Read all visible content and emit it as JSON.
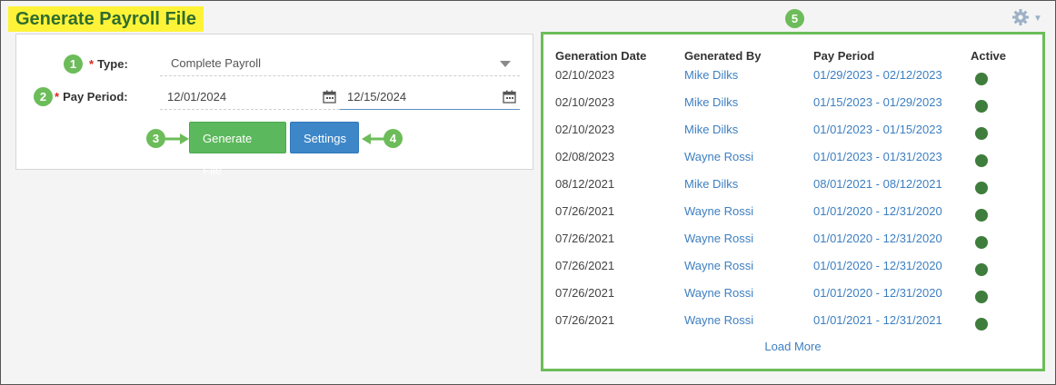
{
  "header": {
    "title": "Generate Payroll File",
    "settings_icon": "gear-icon"
  },
  "callouts": [
    "1",
    "2",
    "3",
    "4",
    "5"
  ],
  "form": {
    "type_label": "Type:",
    "type_required": "*",
    "type_value": "Complete Payroll",
    "period_label": "Pay Period:",
    "period_required": "*",
    "start_date": "12/01/2024",
    "end_date": "12/15/2024",
    "generate_button": "Generate File",
    "settings_button": "Settings"
  },
  "history": {
    "columns": [
      "Generation Date",
      "Generated By",
      "Pay Period",
      "Active"
    ],
    "rows": [
      {
        "date": "02/10/2023",
        "by": "Mike Dilks",
        "period": "01/29/2023 - 02/12/2023",
        "active": true
      },
      {
        "date": "02/10/2023",
        "by": "Mike Dilks",
        "period": "01/15/2023 - 01/29/2023",
        "active": true
      },
      {
        "date": "02/10/2023",
        "by": "Mike Dilks",
        "period": "01/01/2023 - 01/15/2023",
        "active": true
      },
      {
        "date": "02/08/2023",
        "by": "Wayne Rossi",
        "period": "01/01/2023 - 01/31/2023",
        "active": true
      },
      {
        "date": "08/12/2021",
        "by": "Mike Dilks",
        "period": "08/01/2021 - 08/12/2021",
        "active": true
      },
      {
        "date": "07/26/2021",
        "by": "Wayne Rossi",
        "period": "01/01/2020 - 12/31/2020",
        "active": true
      },
      {
        "date": "07/26/2021",
        "by": "Wayne Rossi",
        "period": "01/01/2020 - 12/31/2020",
        "active": true
      },
      {
        "date": "07/26/2021",
        "by": "Wayne Rossi",
        "period": "01/01/2020 - 12/31/2020",
        "active": true
      },
      {
        "date": "07/26/2021",
        "by": "Wayne Rossi",
        "period": "01/01/2020 - 12/31/2020",
        "active": true
      },
      {
        "date": "07/26/2021",
        "by": "Wayne Rossi",
        "period": "01/01/2021 - 12/31/2021",
        "active": true
      }
    ],
    "load_more": "Load More"
  },
  "colors": {
    "title_highlight": "#fff338",
    "callout_green": "#6cbc5a",
    "generate_green": "#5cb85c",
    "settings_blue": "#3d87c8",
    "link_blue": "#3d7fc1",
    "active_dot": "#3f7d3c"
  }
}
